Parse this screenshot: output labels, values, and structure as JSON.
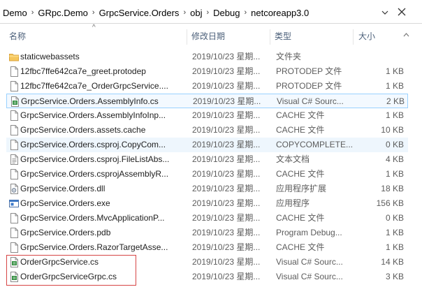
{
  "breadcrumb": [
    "Demo",
    "GRpc.Demo",
    "GrpcService.Orders",
    "obj",
    "Debug",
    "netcoreapp3.0"
  ],
  "columns": {
    "name": "名称",
    "date": "修改日期",
    "type": "类型",
    "size": "大小"
  },
  "files": [
    {
      "name": "staticwebassets",
      "date": "2019/10/23 星期...",
      "type": "文件夹",
      "size": "",
      "icon": "folder-icon"
    },
    {
      "name": "12fbc7ffe642ca7e_greet.protodep",
      "date": "2019/10/23 星期...",
      "type": "PROTODEP 文件",
      "size": "1 KB",
      "icon": "blank-file-icon"
    },
    {
      "name": "12fbc7ffe642ca7e_OrderGrpcService....",
      "date": "2019/10/23 星期...",
      "type": "PROTODEP 文件",
      "size": "1 KB",
      "icon": "blank-file-icon"
    },
    {
      "name": "GrpcService.Orders.AssemblyInfo.cs",
      "date": "2019/10/23 星期...",
      "type": "Visual C# Sourc...",
      "size": "2 KB",
      "icon": "csharp-file-icon"
    },
    {
      "name": "GrpcService.Orders.AssemblyInfoInp...",
      "date": "2019/10/23 星期...",
      "type": "CACHE 文件",
      "size": "1 KB",
      "icon": "blank-file-icon"
    },
    {
      "name": "GrpcService.Orders.assets.cache",
      "date": "2019/10/23 星期...",
      "type": "CACHE 文件",
      "size": "10 KB",
      "icon": "blank-file-icon"
    },
    {
      "name": "GrpcService.Orders.csproj.CopyCom...",
      "date": "2019/10/23 星期...",
      "type": "COPYCOMPLETE...",
      "size": "0 KB",
      "icon": "blank-file-icon"
    },
    {
      "name": "GrpcService.Orders.csproj.FileListAbs...",
      "date": "2019/10/23 星期...",
      "type": "文本文档",
      "size": "4 KB",
      "icon": "text-file-icon"
    },
    {
      "name": "GrpcService.Orders.csprojAssemblyR...",
      "date": "2019/10/23 星期...",
      "type": "CACHE 文件",
      "size": "1 KB",
      "icon": "blank-file-icon"
    },
    {
      "name": "GrpcService.Orders.dll",
      "date": "2019/10/23 星期...",
      "type": "应用程序扩展",
      "size": "18 KB",
      "icon": "dll-file-icon"
    },
    {
      "name": "GrpcService.Orders.exe",
      "date": "2019/10/23 星期...",
      "type": "应用程序",
      "size": "156 KB",
      "icon": "exe-file-icon"
    },
    {
      "name": "GrpcService.Orders.MvcApplicationP...",
      "date": "2019/10/23 星期...",
      "type": "CACHE 文件",
      "size": "0 KB",
      "icon": "blank-file-icon"
    },
    {
      "name": "GrpcService.Orders.pdb",
      "date": "2019/10/23 星期...",
      "type": "Program Debug...",
      "size": "1 KB",
      "icon": "blank-file-icon"
    },
    {
      "name": "GrpcService.Orders.RazorTargetAsse...",
      "date": "2019/10/23 星期...",
      "type": "CACHE 文件",
      "size": "1 KB",
      "icon": "blank-file-icon"
    },
    {
      "name": "OrderGrpcService.cs",
      "date": "2019/10/23 星期...",
      "type": "Visual C# Sourc...",
      "size": "14 KB",
      "icon": "csharp-file-icon"
    },
    {
      "name": "OrderGrpcServiceGrpc.cs",
      "date": "2019/10/23 星期...",
      "type": "Visual C# Sourc...",
      "size": "3 KB",
      "icon": "csharp-file-icon"
    }
  ]
}
